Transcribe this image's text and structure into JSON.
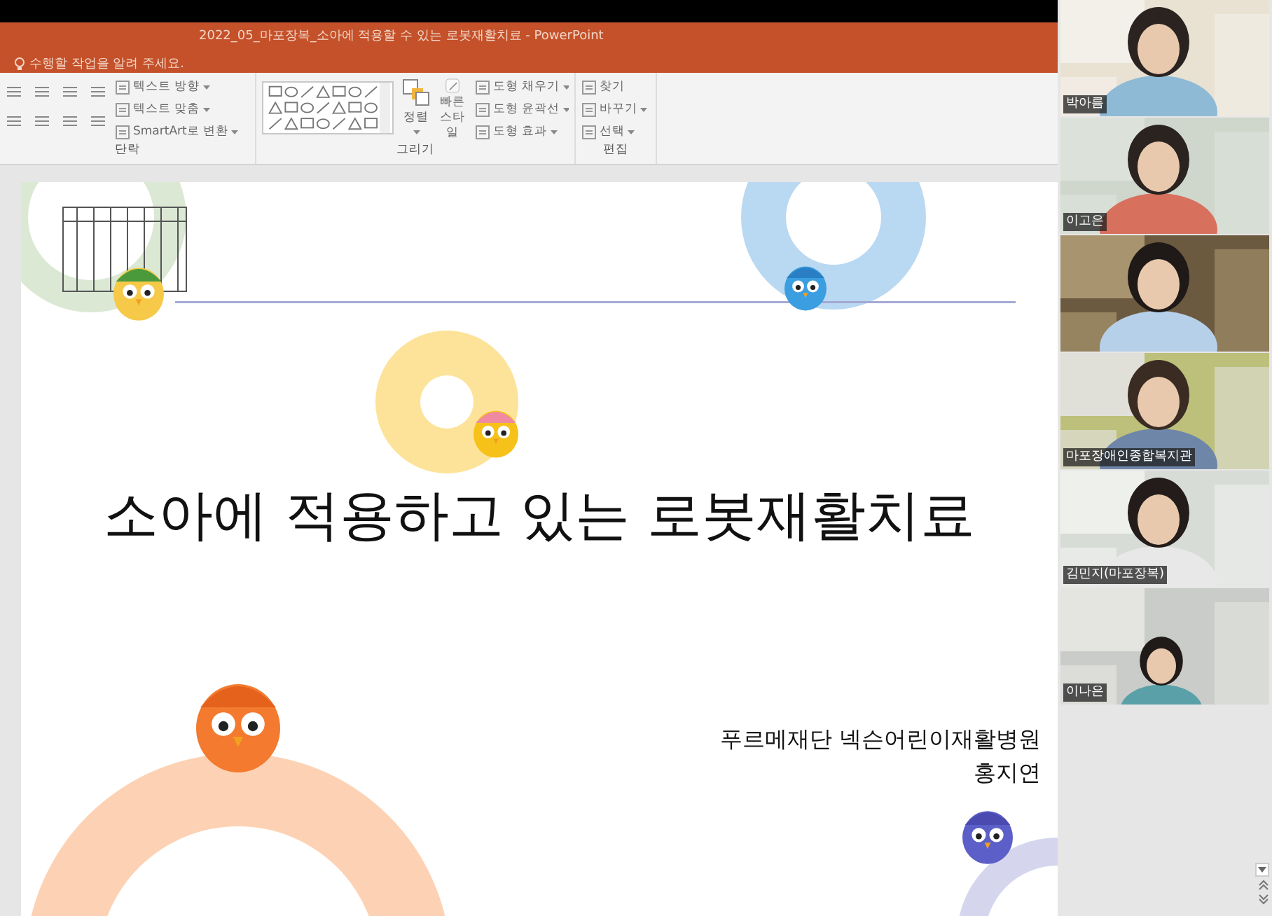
{
  "window": {
    "title": "2022_05_마포장복_소아에 적용할 수 있는 로봇재활치료 - PowerPoint",
    "tell_me": "수행할 작업을 알려 주세요."
  },
  "ribbon": {
    "groups": [
      {
        "kind": "paragraph",
        "label": "단락",
        "items": [
          "텍스트 방향",
          "텍스트 맞춤",
          "SmartArt로 변환"
        ]
      },
      {
        "kind": "drawing",
        "label": "그리기",
        "items": [
          "정렬",
          "빠른 스타일",
          "도형 채우기",
          "도형 윤곽선",
          "도형 효과"
        ]
      },
      {
        "kind": "editing",
        "label": "편집",
        "items": [
          "찾기",
          "바꾸기",
          "선택"
        ]
      }
    ]
  },
  "slide": {
    "title": "소아에 적용하고 있는 로봇재활치료",
    "subtitle_lines": [
      "푸르메재단 넥슨어린이재활병원",
      "홍지연"
    ]
  },
  "participants": [
    {
      "kind": "picture",
      "name": "박아름"
    },
    {
      "kind": "picture",
      "name": "이고은"
    },
    {
      "kind": "picture"
    },
    {
      "kind": "picture",
      "name": "마포장애인종합복지관"
    },
    {
      "kind": "picture",
      "name": "김민지(마포장복)"
    },
    {
      "kind": "picture",
      "name": "이나은"
    }
  ]
}
